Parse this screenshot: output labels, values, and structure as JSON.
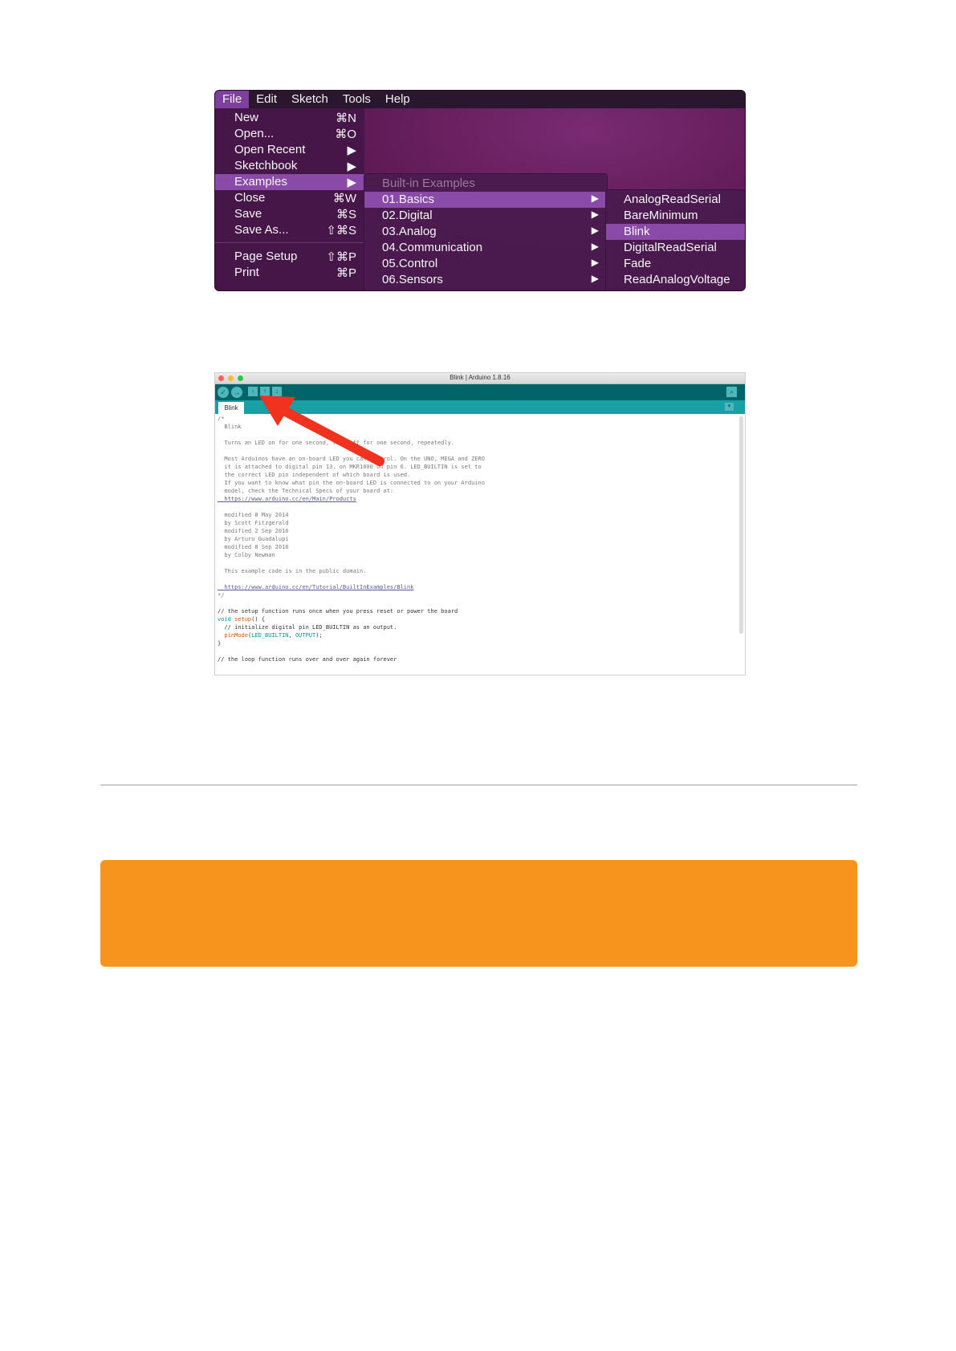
{
  "menu_screenshot": {
    "menubar": [
      "File",
      "Edit",
      "Sketch",
      "Tools",
      "Help"
    ],
    "file_menu": [
      {
        "label": "New",
        "shortcut": "⌘N"
      },
      {
        "label": "Open...",
        "shortcut": "⌘O"
      },
      {
        "label": "Open Recent",
        "shortcut": "▶"
      },
      {
        "label": "Sketchbook",
        "shortcut": "▶"
      },
      {
        "label": "Examples",
        "shortcut": "▶"
      },
      {
        "label": "Close",
        "shortcut": "⌘W"
      },
      {
        "label": "Save",
        "shortcut": "⌘S"
      },
      {
        "label": "Save As...",
        "shortcut": "⇧⌘S"
      },
      {
        "label": "Page Setup",
        "shortcut": "⇧⌘P"
      },
      {
        "label": "Print",
        "shortcut": "⌘P"
      }
    ],
    "examples_header": "Built-in Examples",
    "examples": [
      "01.Basics",
      "02.Digital",
      "03.Analog",
      "04.Communication",
      "05.Control",
      "06.Sensors"
    ],
    "basics": [
      "AnalogReadSerial",
      "BareMinimum",
      "Blink",
      "DigitalReadSerial",
      "Fade",
      "ReadAnalogVoltage"
    ],
    "colors": {
      "highlight": "#8a4aa8",
      "menubar": "#2b1630",
      "desktop": "#5e1a55"
    }
  },
  "ide_screenshot": {
    "window_title": "Blink | Arduino 1.8.16",
    "tab": "Blink",
    "code": {
      "l01": "/*",
      "l02": "  Blink",
      "l03": "  Turns an LED on for one second, then off for one second, repeatedly.",
      "l04": "  Most Arduinos have an on-board LED you can control. On the UNO, MEGA and ZERO",
      "l05": "  it is attached to digital pin 13, on MKR1000 on pin 6. LED_BUILTIN is set to",
      "l06": "  the correct LED pin independent of which board is used.",
      "l07": "  If you want to know what pin the on-board LED is connected to on your Arduino",
      "l08": "  model, check the Technical Specs of your board at:",
      "l09": "  https://www.arduino.cc/en/Main/Products",
      "l10": "  modified 8 May 2014",
      "l11": "  by Scott Fitzgerald",
      "l12": "  modified 2 Sep 2016",
      "l13": "  by Arturo Guadalupi",
      "l14": "  modified 8 Sep 2016",
      "l15": "  by Colby Newman",
      "l16": "  This example code is in the public domain.",
      "l17": "  https://www.arduino.cc/en/Tutorial/BuiltInExamples/Blink",
      "l18": "*/",
      "l19": "// the setup function runs once when you press reset or power the board",
      "l20a": "void",
      "l20b": " setup",
      "l20c": "() {",
      "l21": "  // initialize digital pin LED_BUILTIN as an output.",
      "l22a": "  pinMode",
      "l22b": "(",
      "l22c": "LED_BUILTIN",
      "l22d": ", ",
      "l22e": "OUTPUT",
      "l22f": ");",
      "l23": "}",
      "l24": "// the loop function runs over and over again forever"
    },
    "colors": {
      "toolbar": "#006468",
      "tabbar": "#17a1a5",
      "arrow": "#f0321e"
    }
  },
  "notice_color": "#f7941d"
}
